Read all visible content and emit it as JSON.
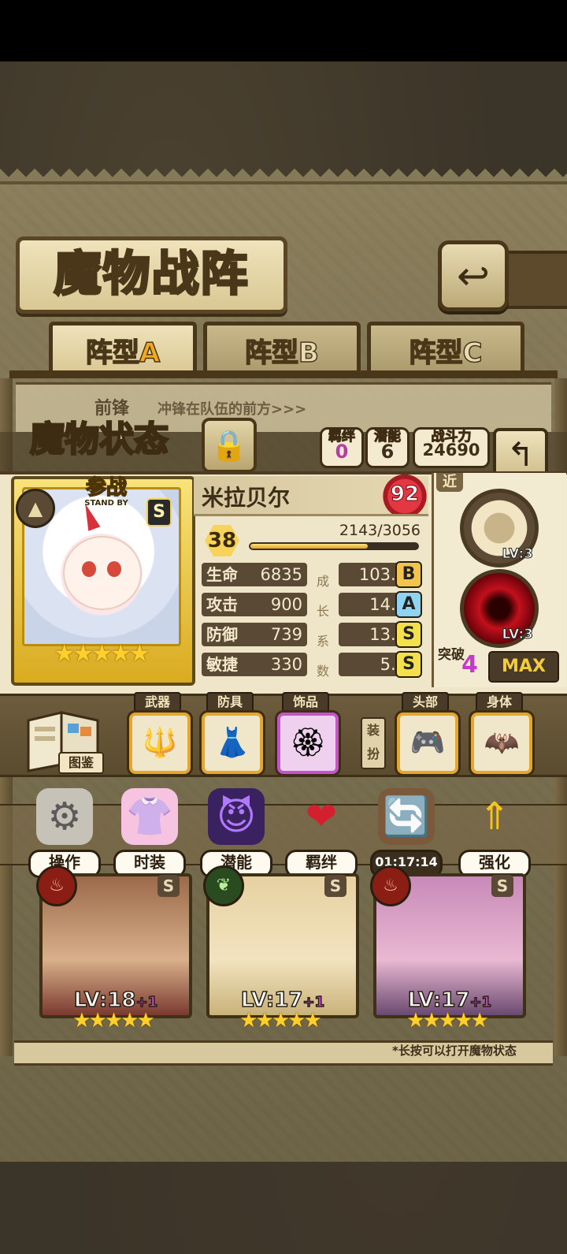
{
  "header": {
    "title": "魔物战阵",
    "back_icon": "return-arrow-icon"
  },
  "formation_tabs": [
    {
      "prefix": "阵型",
      "letter": "A",
      "active": true
    },
    {
      "prefix": "阵型",
      "letter": "B",
      "active": false
    },
    {
      "prefix": "阵型",
      "letter": "C",
      "active": false
    }
  ],
  "vanguard": {
    "label": "前锋",
    "desc": "冲锋在队伍的前方>>>"
  },
  "status": {
    "title": "魔物状态",
    "bond_label": "羁绊",
    "bond_value": "0",
    "potential_label": "潜能",
    "potential_value": "6",
    "power_label": "战斗力",
    "power_value": "24690"
  },
  "character": {
    "badge": "参战",
    "badge_sub": "STAND BY",
    "rank": "S",
    "name": "米拉贝尔",
    "affinity": "92",
    "level": "38",
    "exp_text": "2143/3056",
    "exp_fraction": 0.701,
    "stars": "★★★★★",
    "stats": [
      {
        "name": "生命",
        "value": "6835",
        "growth": "103.0",
        "grade": "B",
        "grade_color": "#f3c44a"
      },
      {
        "name": "攻击",
        "value": "900",
        "growth": "14.8",
        "grade": "A",
        "grade_color": "#8fd3f2"
      },
      {
        "name": "防御",
        "value": "739",
        "growth": "13.0",
        "grade": "S",
        "grade_color": "#f4e04a"
      },
      {
        "name": "敏捷",
        "value": "330",
        "growth": "5.3",
        "grade": "S",
        "grade_color": "#f4e04a"
      }
    ],
    "growth_chars": [
      "成",
      "长",
      "系",
      "数"
    ]
  },
  "skills": {
    "range_tag": "近",
    "skill1_lv": "LV:3",
    "skill2_lv": "LV:3",
    "break_label": "突破",
    "break_value": "4",
    "max_label": "MAX"
  },
  "equipment": {
    "book_label": "图鉴",
    "weapon_label": "武器",
    "armor_label": "防具",
    "accessory_label": "饰品",
    "dress_label": "装扮",
    "head_label": "头部",
    "body_label": "身体"
  },
  "actions": [
    {
      "label": "操作",
      "icon": "gear-icon"
    },
    {
      "label": "时装",
      "icon": "outfit-icon"
    },
    {
      "label": "潜能",
      "icon": "demon-icon"
    },
    {
      "label": "羁绊",
      "icon": "hearts-icon"
    },
    {
      "label": "01:17:14",
      "icon": "refresh-chest-icon"
    },
    {
      "label": "强化",
      "icon": "upgrade-arrows-icon"
    }
  ],
  "heroes": [
    {
      "lv": "LV:18",
      "plus": "+1",
      "rank": "S",
      "element": "fire-icon",
      "stars": "★★★★★"
    },
    {
      "lv": "LV:17",
      "plus": "+1",
      "rank": "S",
      "element": "leaf-icon",
      "stars": "★★★★★"
    },
    {
      "lv": "LV:17",
      "plus": "+1",
      "rank": "S",
      "element": "fire-icon",
      "stars": "★★★★★"
    }
  ],
  "hint": "*长按可以打开魔物状态"
}
